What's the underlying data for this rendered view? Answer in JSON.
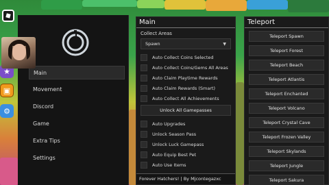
{
  "hud": {
    "roblox_icon": "roblox-logo-icon",
    "purple_icon": "pet-icon",
    "orange_icon": "gift-icon",
    "blue_icon": "gear-icon"
  },
  "sidebar": {
    "logo_icon": "spiral-logo-icon",
    "items": [
      {
        "label": "Main",
        "active": true
      },
      {
        "label": "Movement",
        "active": false
      },
      {
        "label": "Discord",
        "active": false
      },
      {
        "label": "Game",
        "active": false
      },
      {
        "label": "Extra Tips",
        "active": false
      },
      {
        "label": "Settings",
        "active": false
      }
    ]
  },
  "main": {
    "title": "Main",
    "collect_areas_label": "Collect Areas",
    "dropdown_value": "Spawn",
    "options": [
      "Auto Collect Coins Selected",
      "Auto Collect Coins/Gems All Areas",
      "Auto Claim Playtime Rewards",
      "Auto Claim Rewards (Smart)",
      "Auto Collect All Achievements"
    ],
    "unlock_gamepasses": "Unlock All Gamepasses",
    "options2": [
      "Auto Upgrades",
      "Unlock Season Pass",
      "Unlock Luck Gamepass",
      "Auto Equip Best Pet",
      "Auto Use Items"
    ],
    "footer": "Forever Hatchers! | By Mjcontegazxc"
  },
  "teleport": {
    "title": "Teleport",
    "items": [
      "Teleport Spawn",
      "Teleport Forest",
      "Teleport Beach",
      "Teleport Atlantis",
      "Teleport Enchanted",
      "Teleport Volcano",
      "Teleport Crystal Cave",
      "Teleport Frozen Valley",
      "Teleport Skylands",
      "Teleport Jungle",
      "Teleport Sakura"
    ]
  }
}
